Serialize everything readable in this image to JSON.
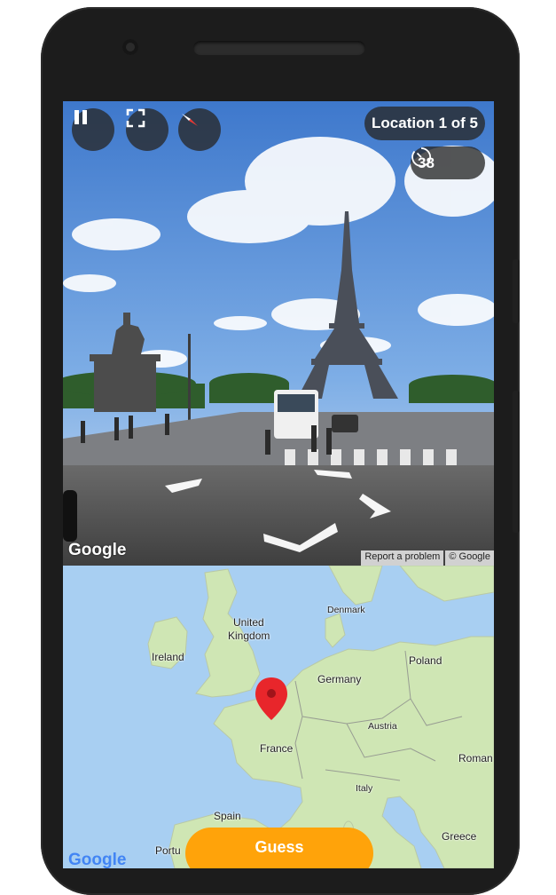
{
  "round": {
    "location_label": "Location 1 of 5",
    "timer_seconds": "38"
  },
  "controls": {
    "pause_icon": "pause-icon",
    "fullscreen_icon": "fullscreen-icon",
    "compass_icon": "compass-icon",
    "timer_icon": "timer-icon"
  },
  "streetview": {
    "logo": "Google",
    "report_label": "Report a problem",
    "copyright": "© Google"
  },
  "map": {
    "labels": [
      {
        "text": "United",
        "name": "map-label-united"
      },
      {
        "text": "Kingdom",
        "name": "map-label-kingdom"
      },
      {
        "text": "Ireland",
        "name": "map-label-ireland"
      },
      {
        "text": "Denmark",
        "name": "map-label-denmark"
      },
      {
        "text": "Poland",
        "name": "map-label-poland"
      },
      {
        "text": "Germany",
        "name": "map-label-germany"
      },
      {
        "text": "Austria",
        "name": "map-label-austria"
      },
      {
        "text": "France",
        "name": "map-label-france"
      },
      {
        "text": "Roman",
        "name": "map-label-romania"
      },
      {
        "text": "Italy",
        "name": "map-label-italy"
      },
      {
        "text": "Spain",
        "name": "map-label-spain"
      },
      {
        "text": "Portu",
        "name": "map-label-portugal"
      },
      {
        "text": "Greece",
        "name": "map-label-greece"
      }
    ],
    "logo": "Google",
    "colors": {
      "water": "#a8cff2",
      "land": "#cfe6b4",
      "pin": "#e8262b"
    }
  },
  "guess_button": {
    "label": "Guess",
    "color": "#ffa30a"
  }
}
